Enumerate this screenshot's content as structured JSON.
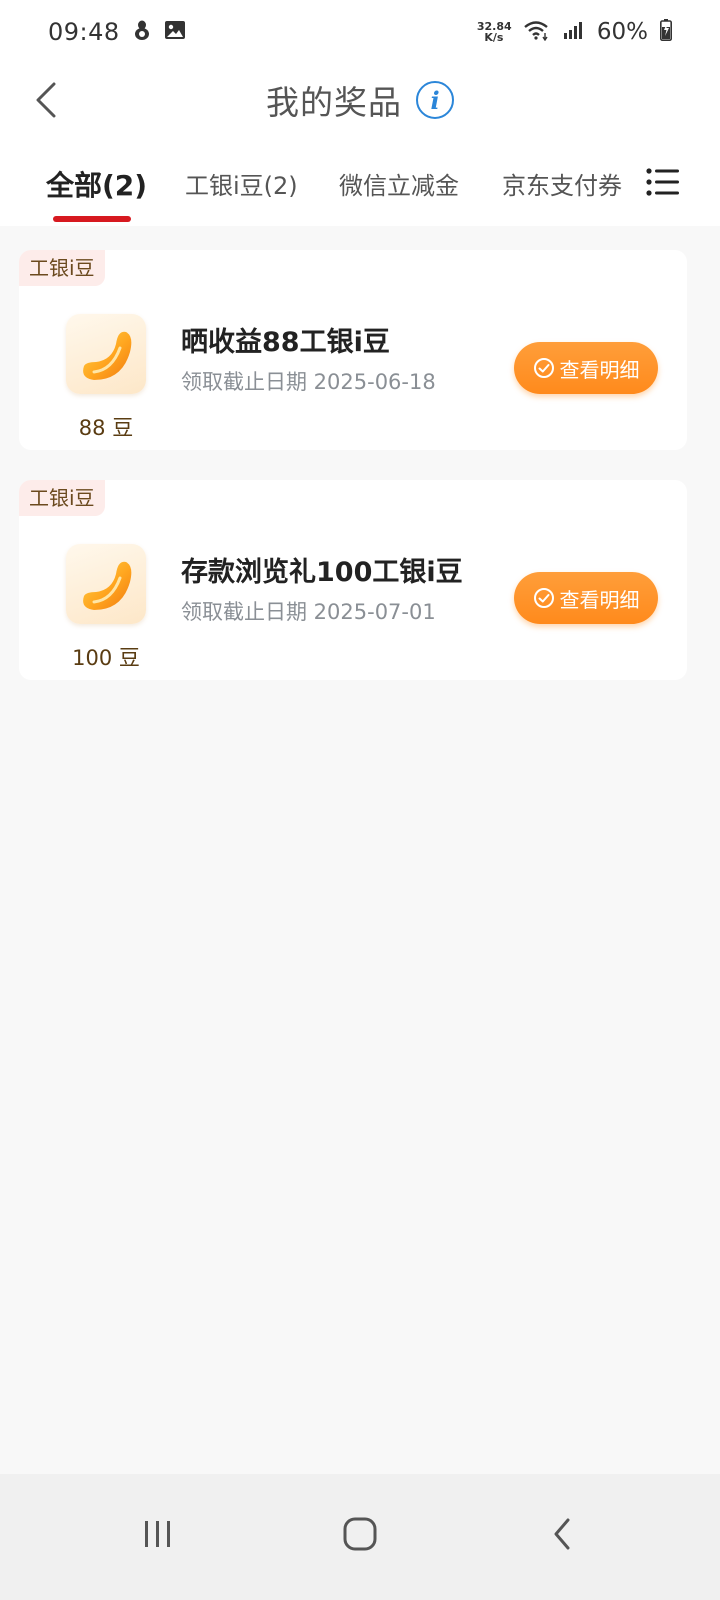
{
  "status_bar": {
    "time": "09:48",
    "net_speed_value": "32.84",
    "net_speed_unit": "K/s",
    "battery_percent": "60%"
  },
  "header": {
    "title": "我的奖品",
    "info_label": "i"
  },
  "tabs": [
    {
      "label": "全部(2)",
      "active": true
    },
    {
      "label": "工银i豆(2)",
      "active": false
    },
    {
      "label": "微信立减金",
      "active": false
    },
    {
      "label": "京东支付券",
      "active": false
    }
  ],
  "prizes": [
    {
      "tag": "工银i豆",
      "amount_label": "88 豆",
      "name": "晒收益88工银i豆",
      "deadline": "领取截止日期 2025-06-18",
      "button_label": "查看明细"
    },
    {
      "tag": "工银i豆",
      "amount_label": "100 豆",
      "name": "存款浏览礼100工银i豆",
      "deadline": "领取截止日期 2025-07-01",
      "button_label": "查看明细"
    }
  ],
  "colors": {
    "accent_red": "#d71920",
    "button_orange": "#ff8a1c",
    "info_blue": "#2b86d9",
    "tag_bg": "#fdecea"
  }
}
